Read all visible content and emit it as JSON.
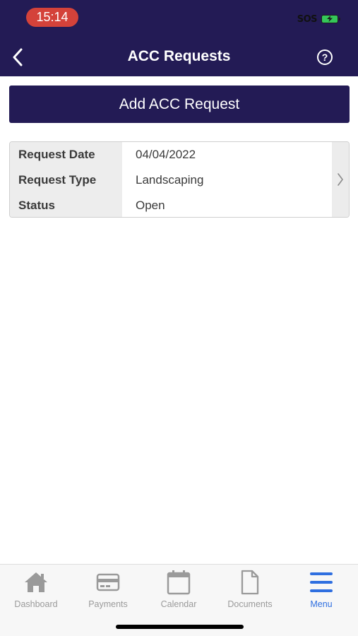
{
  "status_bar": {
    "time": "15:14",
    "carrier_text": "SOS",
    "battery_icon": "battery-charging-icon"
  },
  "nav": {
    "title": "ACC Requests",
    "back_icon": "chevron-left-icon",
    "help_label": "?"
  },
  "add_button": {
    "label": "Add ACC Request"
  },
  "requests": [
    {
      "rows": [
        {
          "label": "Request Date",
          "value": "04/04/2022"
        },
        {
          "label": "Request Type",
          "value": "Landscaping"
        },
        {
          "label": "Status",
          "value": "Open"
        }
      ]
    }
  ],
  "tabbar": {
    "tabs": [
      {
        "label": "Dashboard",
        "icon": "home-icon",
        "active": false
      },
      {
        "label": "Payments",
        "icon": "credit-card-icon",
        "active": false
      },
      {
        "label": "Calendar",
        "icon": "calendar-icon",
        "active": false
      },
      {
        "label": "Documents",
        "icon": "document-icon",
        "active": false
      },
      {
        "label": "Menu",
        "icon": "hamburger-menu-icon",
        "active": true
      }
    ]
  },
  "colors": {
    "header_bg": "#231b55",
    "active_tab": "#2f6fe0",
    "time_pill": "#d4423a",
    "battery": "#35c759"
  }
}
